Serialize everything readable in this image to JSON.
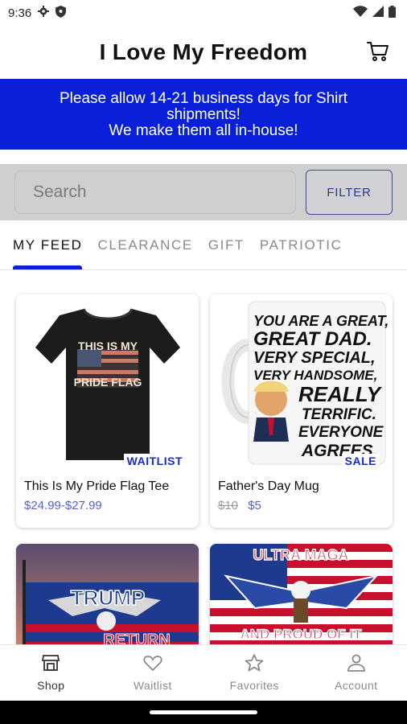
{
  "status": {
    "time": "9:36"
  },
  "header": {
    "title": "I Love My Freedom",
    "cart_icon": "cart-icon"
  },
  "banner": {
    "line1": "Please allow 14-21 business days for Shirt shipments!",
    "line2": "We make them all in-house!",
    "background": "#0a1fd8"
  },
  "search": {
    "placeholder": "Search",
    "filter_label": "FILTER"
  },
  "tabs": [
    {
      "label": "MY FEED",
      "active": true
    },
    {
      "label": "CLEARANCE"
    },
    {
      "label": "GIFT"
    },
    {
      "label": "PATRIOTIC"
    }
  ],
  "products": [
    {
      "title": "This Is My Pride Flag Tee",
      "price": "$24.99-$27.99",
      "badge": "WAITLIST",
      "image_text": [
        "THIS IS MY",
        "PRIDE FLAG"
      ]
    },
    {
      "title": "Father's Day Mug",
      "old_price": "$10",
      "price": "$5",
      "badge": "SALE",
      "image_text": [
        "YOU ARE A GREAT,",
        "GREAT DAD.",
        "VERY SPECIAL,",
        "VERY HANDSOME,",
        "REALLY",
        "TERRIFIC.",
        "EVERYONE",
        "AGREES."
      ]
    },
    {
      "image_text": [
        "TRUMP",
        "RETURN"
      ]
    },
    {
      "image_text": [
        "ULTRA MAGA",
        "AND PROUD OF IT"
      ]
    }
  ],
  "nav": [
    {
      "label": "Shop",
      "icon": "shop-icon",
      "active": true
    },
    {
      "label": "Waitlist",
      "icon": "heart-icon"
    },
    {
      "label": "Favorites",
      "icon": "star-icon"
    },
    {
      "label": "Account",
      "icon": "account-icon"
    }
  ],
  "colors": {
    "accent": "#0a1fd8",
    "price": "#5560cf"
  }
}
